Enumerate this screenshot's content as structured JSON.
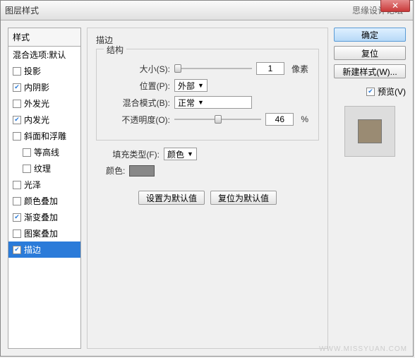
{
  "titlebar": {
    "title": "图层样式",
    "subtitle": "思缘设计论坛"
  },
  "left": {
    "header": "样式",
    "blend_default": "混合选项:默认",
    "items": [
      {
        "key": "drop-shadow",
        "label": "投影",
        "checked": false,
        "indent": false
      },
      {
        "key": "inner-shadow",
        "label": "内阴影",
        "checked": true,
        "indent": false
      },
      {
        "key": "outer-glow",
        "label": "外发光",
        "checked": false,
        "indent": false
      },
      {
        "key": "inner-glow",
        "label": "内发光",
        "checked": true,
        "indent": false
      },
      {
        "key": "bevel",
        "label": "斜面和浮雕",
        "checked": false,
        "indent": false
      },
      {
        "key": "contour",
        "label": "等高线",
        "checked": false,
        "indent": true
      },
      {
        "key": "texture",
        "label": "纹理",
        "checked": false,
        "indent": true
      },
      {
        "key": "satin",
        "label": "光泽",
        "checked": false,
        "indent": false
      },
      {
        "key": "color-overlay",
        "label": "颜色叠加",
        "checked": false,
        "indent": false
      },
      {
        "key": "gradient-overlay",
        "label": "渐变叠加",
        "checked": true,
        "indent": false
      },
      {
        "key": "pattern-overlay",
        "label": "图案叠加",
        "checked": false,
        "indent": false
      },
      {
        "key": "stroke",
        "label": "描边",
        "checked": true,
        "indent": false,
        "selected": true
      }
    ]
  },
  "mid": {
    "panel_title": "描边",
    "structure_legend": "结构",
    "size_label": "大小(S):",
    "size_value": "1",
    "size_unit": "像素",
    "position_label": "位置(P):",
    "position_value": "外部",
    "blend_label": "混合模式(B):",
    "blend_value": "正常",
    "opacity_label": "不透明度(O):",
    "opacity_value": "46",
    "opacity_unit": "%",
    "filltype_label": "填充类型(F):",
    "filltype_value": "颜色",
    "color_label": "颜色:",
    "color_hex": "#888888",
    "btn_set_default": "设置为默认值",
    "btn_reset_default": "复位为默认值"
  },
  "right": {
    "ok": "确定",
    "reset": "复位",
    "new_style": "新建样式(W)...",
    "preview_label": "预览(V)",
    "preview_checked": true
  },
  "watermark": "WWW.MISSYUAN.COM"
}
